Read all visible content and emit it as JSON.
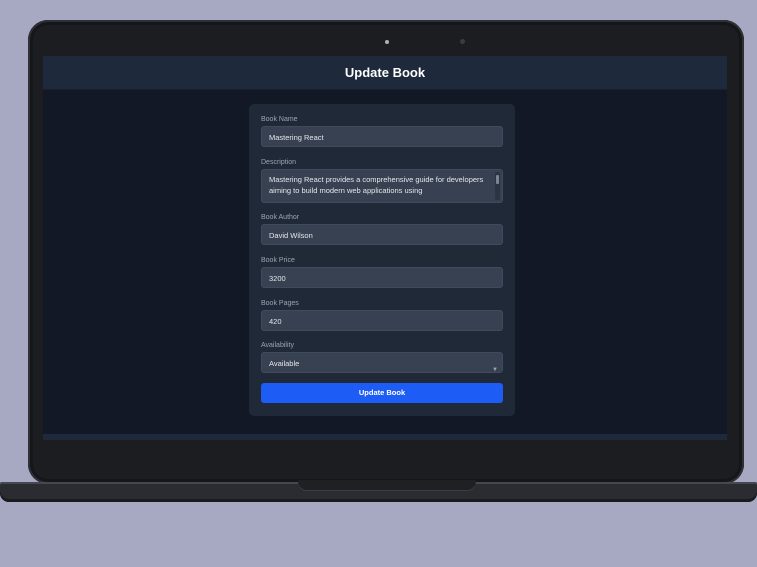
{
  "header": {
    "title": "Update Book"
  },
  "form": {
    "book_name": {
      "label": "Book Name",
      "value": "Mastering React"
    },
    "description": {
      "label": "Description",
      "value": "Mastering React provides a comprehensive guide for developers aiming to build modern web applications using"
    },
    "book_author": {
      "label": "Book Author",
      "value": "David Wilson"
    },
    "book_price": {
      "label": "Book Price",
      "value": "3200"
    },
    "book_pages": {
      "label": "Book Pages",
      "value": "420"
    },
    "availability": {
      "label": "Availability",
      "value": "Available"
    },
    "submit_label": "Update Book"
  },
  "colors": {
    "page_background": "#121826",
    "header": "#1e293b",
    "card": "#1f2937",
    "input": "#374151",
    "button": "#1d5cf5"
  },
  "icons": {
    "select_chevron": "chevron-down-icon"
  }
}
